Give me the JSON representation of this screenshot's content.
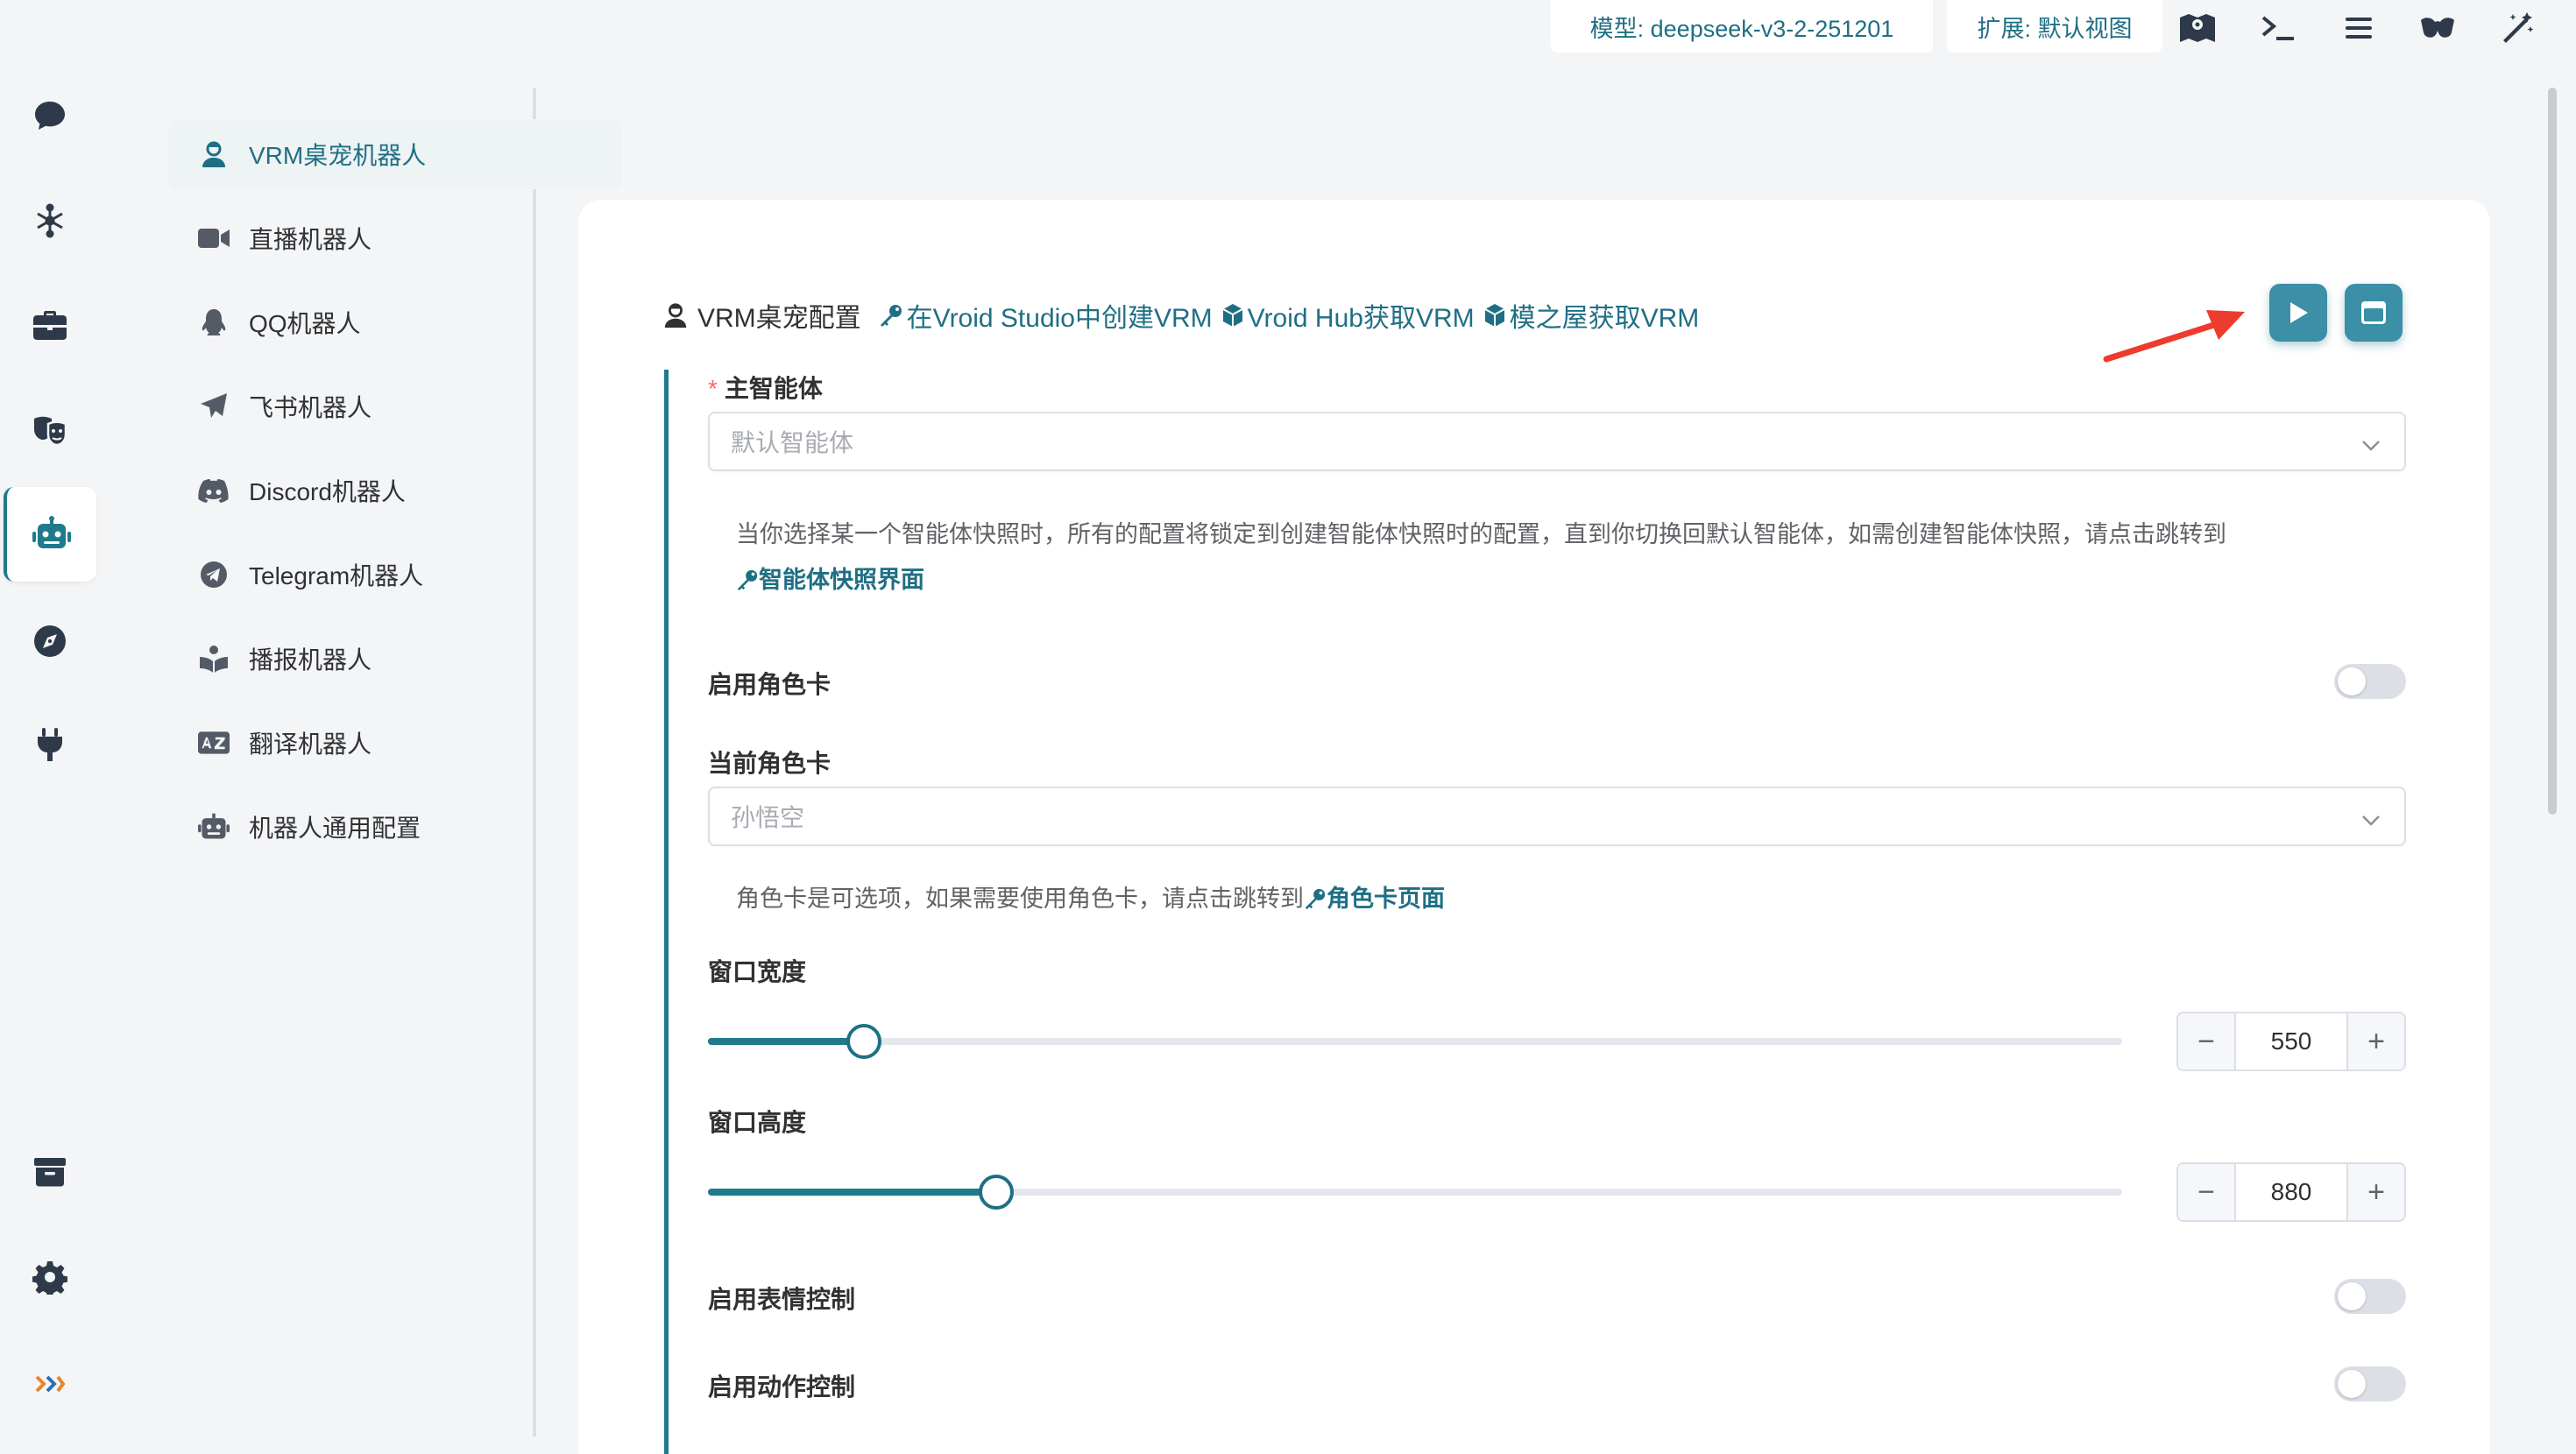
{
  "toolbar": {
    "model_label": "模型: deepseek-v3-2-251201",
    "extension_label": "扩展: 默认视图",
    "icons": [
      "map-icon",
      "terminal-icon",
      "menu-icon",
      "glasses-icon",
      "magic-wand-icon"
    ]
  },
  "rail": {
    "icons": [
      "chat-icon",
      "network-icon",
      "toolbox-icon",
      "masks-icon",
      "robot-icon",
      "compass-icon",
      "plug-icon",
      "archive-icon",
      "settings-icon",
      "logo-icon"
    ],
    "active": "robot-icon"
  },
  "submenu": {
    "items": [
      {
        "label": "VRM桌宠机器人",
        "icon": "vrm-user-icon",
        "active": true
      },
      {
        "label": "直播机器人",
        "icon": "video-icon"
      },
      {
        "label": "QQ机器人",
        "icon": "qq-icon"
      },
      {
        "label": "飞书机器人",
        "icon": "paper-plane-icon"
      },
      {
        "label": "Discord机器人",
        "icon": "discord-icon"
      },
      {
        "label": "Telegram机器人",
        "icon": "telegram-icon"
      },
      {
        "label": "播报机器人",
        "icon": "reader-icon"
      },
      {
        "label": "翻译机器人",
        "icon": "translate-icon"
      },
      {
        "label": "机器人通用配置",
        "icon": "robot-config-icon"
      }
    ]
  },
  "card": {
    "title": "VRM桌宠配置",
    "links": [
      {
        "label": "在Vroid Studio中创建VRM",
        "icon": "key-icon"
      },
      {
        "label": "Vroid Hub获取VRM",
        "icon": "cube-icon"
      },
      {
        "label": "模之屋获取VRM",
        "icon": "cube-icon"
      }
    ]
  },
  "form": {
    "main_agent": {
      "required_mark": "*",
      "label": "主智能体",
      "value": "默认智能体",
      "hint": "当你选择某一个智能体快照时，所有的配置将锁定到创建智能体快照时的配置，直到你切换回默认智能体，如需创建智能体快照，请点击跳转到",
      "hint_link": "智能体快照界面"
    },
    "enable_role_card": {
      "label": "启用角色卡",
      "on": false
    },
    "current_role_card": {
      "label": "当前角色卡",
      "value": "孙悟空",
      "hint": "角色卡是可选项，如果需要使用角色卡，请点击跳转到",
      "hint_link": "角色卡页面"
    },
    "window_width": {
      "label": "窗口宽度",
      "value": "550",
      "fraction": 0.11
    },
    "window_height": {
      "label": "窗口高度",
      "value": "880",
      "fraction": 0.204
    },
    "enable_expression": {
      "label": "启用表情控制",
      "on": false
    },
    "enable_motion": {
      "label": "启用动作控制",
      "on": false
    }
  },
  "colors": {
    "accent": "#1f6f84",
    "button": "#3b8fa6",
    "required": "#f56c6c",
    "arrow": "#ee3b2f"
  }
}
